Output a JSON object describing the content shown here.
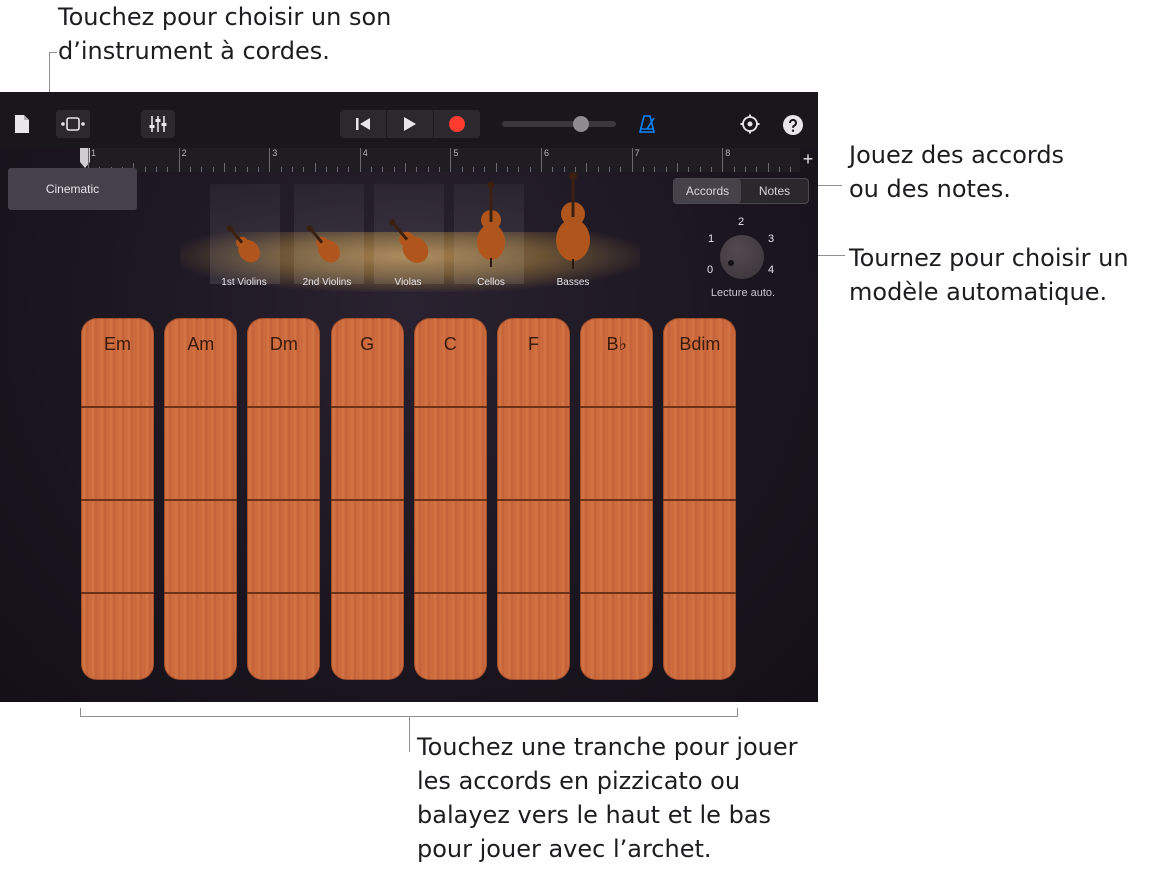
{
  "callouts": {
    "top_left": "Touchez pour choisir un son\nd’instrument à cordes.",
    "right_mode": "Jouez des accords\nou des notes.",
    "right_autoplay": "Tournez pour choisir un\nmodèle automatique.",
    "bottom": "Touchez une tranche pour jouer\nles accords en pizzicato ou\nbalayez vers le haut et le bas\npour jouer avec l’archet."
  },
  "ruler": {
    "bars": [
      "1",
      "2",
      "3",
      "4",
      "5",
      "6",
      "7",
      "8"
    ],
    "add_label": "+"
  },
  "instrument_browser": {
    "label": "Cinematic"
  },
  "instruments": [
    {
      "name": "1st Violins",
      "icon": "violin-icon"
    },
    {
      "name": "2nd Violins",
      "icon": "violin-icon"
    },
    {
      "name": "Violas",
      "icon": "viola-icon"
    },
    {
      "name": "Cellos",
      "icon": "cello-icon"
    },
    {
      "name": "Basses",
      "icon": "bass-icon"
    }
  ],
  "mode_toggle": {
    "chords": "Accords",
    "notes": "Notes",
    "selected": "Accords"
  },
  "autoplay": {
    "label": "Lecture auto.",
    "positions": [
      "0",
      "1",
      "2",
      "3",
      "4"
    ],
    "selected": "0"
  },
  "chords": [
    "Em",
    "Am",
    "Dm",
    "G",
    "C",
    "F",
    "B♭",
    "Bdim"
  ],
  "volume": {
    "level": 0.72
  },
  "colors": {
    "record": "#ff3b30",
    "metronome": "#0a84ff",
    "wood": "#c8663a"
  }
}
